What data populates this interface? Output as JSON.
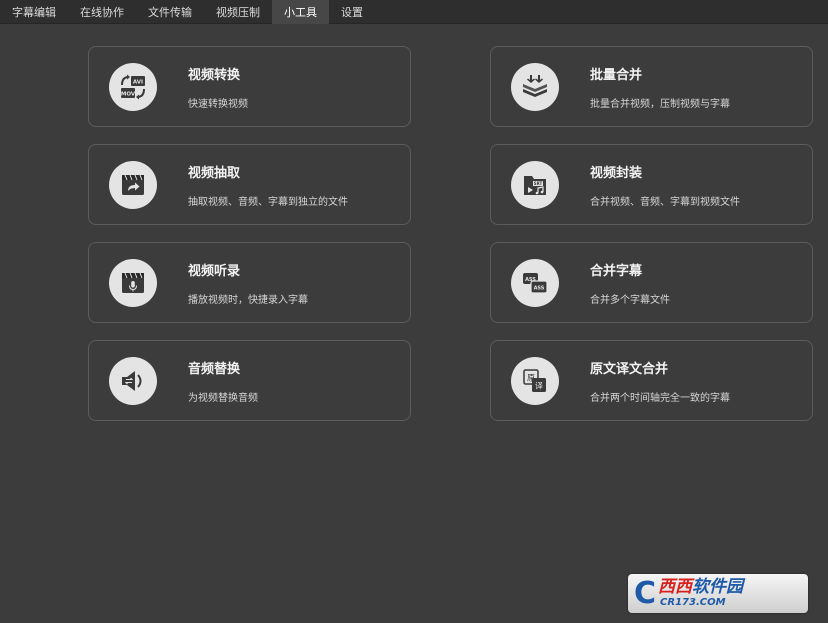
{
  "menubar": {
    "items": [
      {
        "label": "字幕编辑",
        "active": false
      },
      {
        "label": "在线协作",
        "active": false
      },
      {
        "label": "文件传输",
        "active": false
      },
      {
        "label": "视频压制",
        "active": false
      },
      {
        "label": "小工具",
        "active": true
      },
      {
        "label": "设置",
        "active": false
      }
    ]
  },
  "tools": [
    {
      "title": "视频转换",
      "desc": "快速转换视频",
      "icon": "video-convert-icon",
      "icon_labels": [
        "AVI",
        "MOV"
      ]
    },
    {
      "title": "批量合并",
      "desc": "批量合并视频，压制视频与字幕",
      "icon": "batch-merge-icon"
    },
    {
      "title": "视频抽取",
      "desc": "抽取视频、音频、字幕到独立的文件",
      "icon": "video-extract-icon"
    },
    {
      "title": "视频封装",
      "desc": "合并视频、音频、字幕到视频文件",
      "icon": "video-package-icon",
      "icon_labels": [
        "SRT"
      ]
    },
    {
      "title": "视频听录",
      "desc": "播放视频时，快捷录入字幕",
      "icon": "video-transcribe-icon"
    },
    {
      "title": "合并字幕",
      "desc": "合并多个字幕文件",
      "icon": "merge-subtitle-icon",
      "icon_labels": [
        "ASS",
        "ASS"
      ]
    },
    {
      "title": "音频替换",
      "desc": "为视频替换音频",
      "icon": "audio-replace-icon"
    },
    {
      "title": "原文译文合并",
      "desc": "合并两个时间轴完全一致的字幕",
      "icon": "bilingual-merge-icon",
      "icon_labels": [
        "原",
        "译"
      ]
    }
  ],
  "watermark": {
    "logo_letter": "C",
    "text_red": "西西",
    "text_blue": "软件园",
    "site": "CR173.COM"
  },
  "colors": {
    "background": "#3c3c3c",
    "menubar": "#2e2e2e",
    "active_tab": "#474747",
    "card_border": "#5c5c5c",
    "icon_circle": "#e4e4e4",
    "icon_glyph": "#3a3a3a"
  }
}
